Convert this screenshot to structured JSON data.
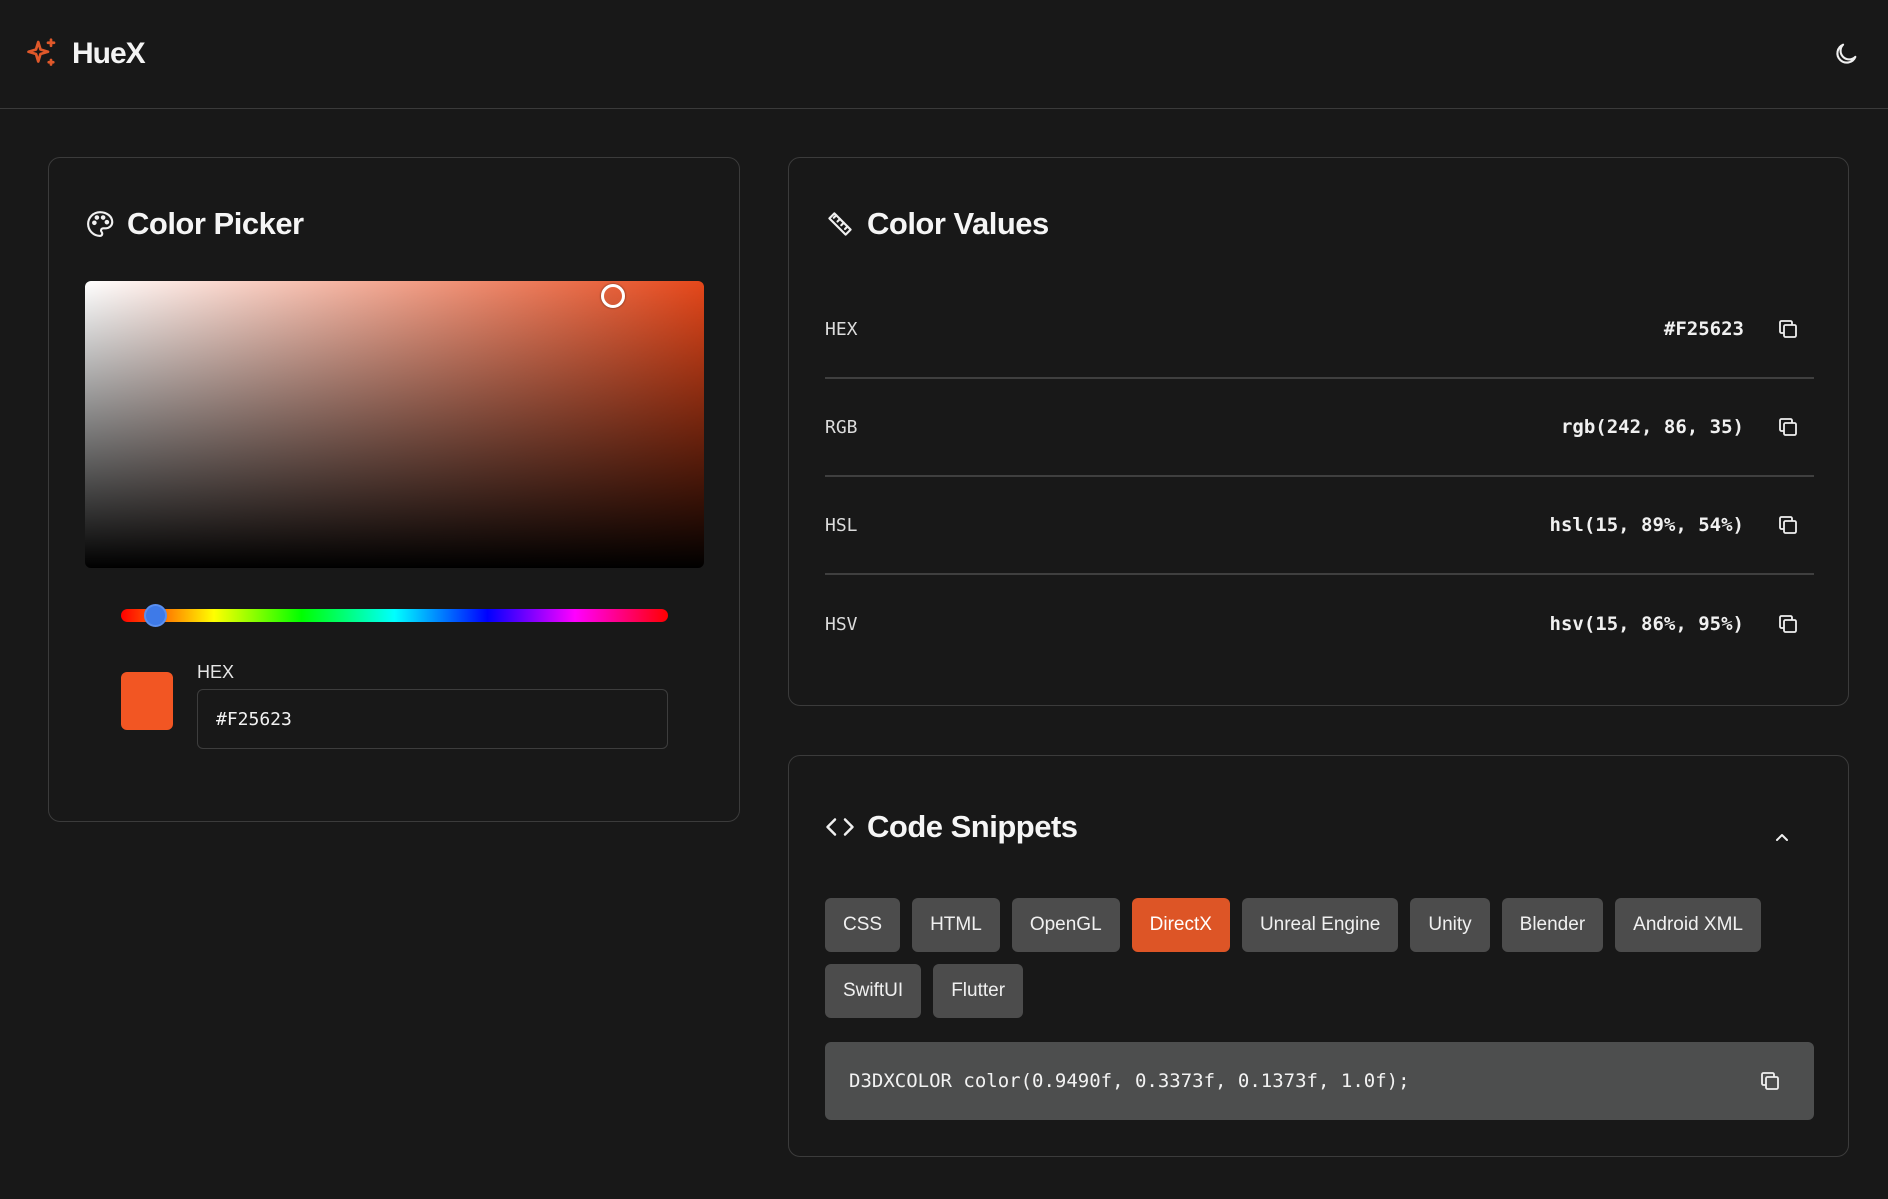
{
  "app": {
    "name": "HueX",
    "logo_icon": "sparkle-icon",
    "accent": "#F25623"
  },
  "header": {
    "theme_toggle_icon": "moon-icon"
  },
  "picker": {
    "title": "Color Picker",
    "icon": "palette-icon",
    "hue_fraction": 0.042,
    "hex_label": "HEX",
    "hex_value": "#F25623",
    "swatch_color": "#F25623"
  },
  "values": {
    "title": "Color Values",
    "icon": "ruler-icon",
    "rows": [
      {
        "label": "HEX",
        "value": "#F25623"
      },
      {
        "label": "RGB",
        "value": "rgb(242, 86, 35)"
      },
      {
        "label": "HSL",
        "value": "hsl(15, 89%, 54%)"
      },
      {
        "label": "HSV",
        "value": "hsv(15, 86%, 95%)"
      }
    ]
  },
  "snippets": {
    "title": "Code Snippets",
    "icon": "code-icon",
    "tabs": [
      "CSS",
      "HTML",
      "OpenGL",
      "DirectX",
      "Unreal Engine",
      "Unity",
      "Blender",
      "Android XML",
      "SwiftUI",
      "Flutter"
    ],
    "active_tab": "DirectX",
    "code": "D3DXCOLOR color(0.9490f, 0.3373f, 0.1373f, 1.0f);"
  }
}
